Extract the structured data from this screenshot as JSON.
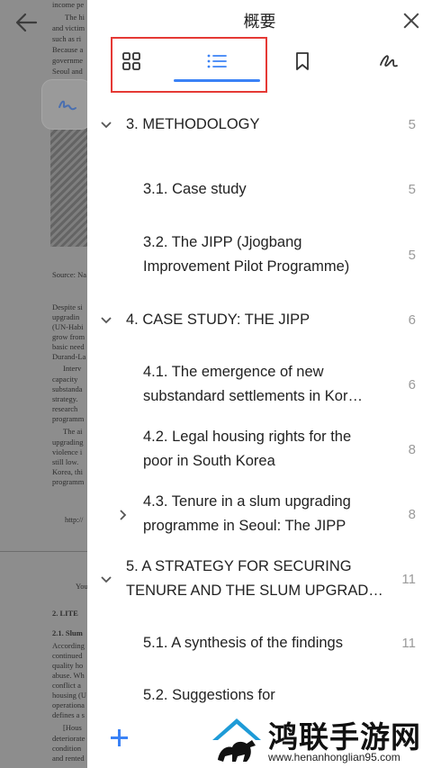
{
  "background_document": {
    "text_lines": [
      "income pe",
      "The hi",
      "and victim",
      "such as ri",
      "Because a",
      "governme",
      "Seoul and",
      "Source: Na",
      "Despite si",
      "upgradin",
      "(UN-Habi",
      "grow from",
      "basic need",
      "Durand-La",
      "Interv",
      "capacity",
      "substanda",
      "strategy.",
      "research",
      "programm",
      "The ai",
      "upgrading",
      "violence i",
      "still low.",
      "Korea, thi",
      "programm",
      "http://",
      "You",
      "2. LITE",
      "2.1. Slum",
      "According",
      "continued",
      "quality ho",
      "abuse. Wh",
      "conflict a",
      "housing (U",
      "operationa",
      "defines a s",
      "[Hous",
      "deteriorate",
      "condition",
      "and rented"
    ]
  },
  "panel": {
    "title": "概要",
    "tabs": [
      {
        "icon": "grid-icon",
        "active": false
      },
      {
        "icon": "list-icon",
        "active": true
      },
      {
        "icon": "bookmark-icon",
        "active": false
      },
      {
        "icon": "pen-icon",
        "active": false
      }
    ],
    "accent_color": "#3b82f6",
    "highlight_color": "#e53935"
  },
  "toc": [
    {
      "level": 1,
      "label": "3. METHODOLOGY",
      "page": "5",
      "chevron": "down"
    },
    {
      "level": 2,
      "label": "3.1. Case study",
      "page": "5",
      "chevron": null
    },
    {
      "level": 2,
      "label": "3.2. The JIPP (Jjogbang Improvement Pilot Programme)",
      "page": "5",
      "chevron": null
    },
    {
      "level": 1,
      "label": "4. CASE STUDY: THE JIPP",
      "page": "6",
      "chevron": "down"
    },
    {
      "level": 2,
      "label_line1": "4.1. The emergence of new",
      "label_line2": "substandard settlements in Kor…",
      "page": "6",
      "chevron": null
    },
    {
      "level": 2,
      "label_line1": "4.2. Legal housing rights for the",
      "label_line2": "poor in South Korea",
      "page": "8",
      "chevron": null
    },
    {
      "level": 2,
      "label_line1": "4.3. Tenure in a slum upgrading",
      "label_line2": "programme in Seoul: The JIPP",
      "page": "8",
      "chevron": "right"
    },
    {
      "level": 1,
      "label_line1": "5. A STRATEGY FOR SECURING",
      "label_line2": "TENURE AND THE SLUM UPGRADI…",
      "page": "11",
      "chevron": "down"
    },
    {
      "level": 2,
      "label": "5.1. A synthesis of the findings",
      "page": "11",
      "chevron": null
    },
    {
      "level": 2,
      "label": "5.2. Suggestions for",
      "page": "",
      "chevron": null
    }
  ],
  "watermark": {
    "title": "鸿联手游网",
    "url": "www.henanhonglian95.com"
  }
}
